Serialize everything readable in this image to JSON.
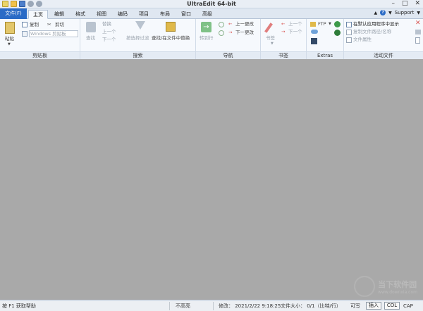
{
  "window": {
    "title": "UltraEdit 64-bit",
    "controls": [
      "–",
      "□",
      "✕"
    ]
  },
  "quick_access": [
    "new-icon",
    "open-icon",
    "save-icon",
    "undo-icon",
    "redo-icon"
  ],
  "tabs": [
    {
      "label": "文件(F)",
      "kind": "file"
    },
    {
      "label": "主页",
      "kind": "active"
    },
    {
      "label": "编辑"
    },
    {
      "label": "格式"
    },
    {
      "label": "视图"
    },
    {
      "label": "编码"
    },
    {
      "label": "项目"
    },
    {
      "label": "布局"
    },
    {
      "label": "窗口"
    },
    {
      "label": "高级"
    }
  ],
  "tab_right": {
    "support": "Support",
    "help": "?"
  },
  "ribbon": {
    "clipboard": {
      "name": "剪贴板",
      "paste": "粘贴",
      "copy": "复制",
      "cut": "剪切",
      "clipboard_select": "Windows 剪贴板"
    },
    "search": {
      "name": "搜索",
      "find": "查找",
      "replace": "替换",
      "prev": "上一个",
      "next": "下一个",
      "filter": "按选择过滤",
      "find_in_files": "查找/在文件中替换"
    },
    "nav": {
      "name": "导航",
      "goto": "转到行",
      "prev_change": "上一更改",
      "next_change": "下一更改"
    },
    "bookmarks": {
      "name": "书签",
      "bookmark": "书签",
      "prev": "上一个",
      "next": "下一个"
    },
    "extras": {
      "name": "Extras",
      "ftp": "FTP"
    },
    "active_file": {
      "name": "活动文件",
      "show_default": "在默认应用程序中显示",
      "copy_path": "复制文件路径/名称",
      "properties": "文件属性"
    }
  },
  "watermark": {
    "cn": "当下软件园",
    "en": "www.downxia.com"
  },
  "status": {
    "help": "按 F1 获取帮助",
    "highlight": "不高亮",
    "modified": "修改： 2021/2/22 9:18:25",
    "filesize": "文件大小： 0/1（比特/行）",
    "writable": "可写",
    "insert": "插入",
    "col": "COL",
    "cap": "CAP"
  },
  "colors": {
    "accent": "#2a6bc6",
    "workspace": "#a9a9a9",
    "ribbon": "#f6f9fd"
  }
}
